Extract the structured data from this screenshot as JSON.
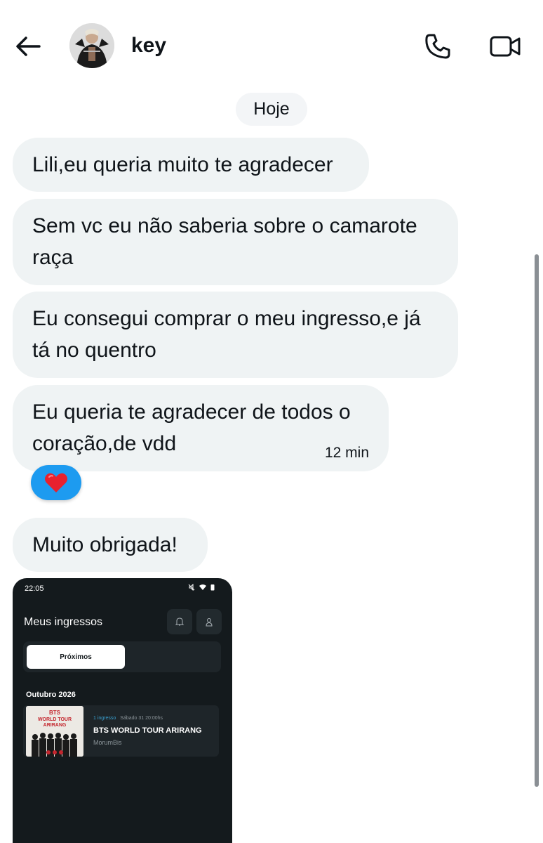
{
  "header": {
    "contact_name": "key",
    "back_icon": "arrow-left-icon",
    "call_icon": "phone-icon",
    "video_icon": "video-camera-icon"
  },
  "date_separator": "Hoje",
  "messages": [
    {
      "lines": [
        "Lili,eu queria muito te agradecer"
      ]
    },
    {
      "lines": [
        "Sem vc eu não saberia sobre o camarote",
        "raça"
      ]
    },
    {
      "lines": [
        "Eu consegui comprar o meu ingresso,e já",
        "tá no quentro"
      ]
    },
    {
      "lines": [
        "Eu queria te agradecer de todos o",
        "coração,de vdd"
      ],
      "timestamp": "12 min",
      "reaction": "❤️"
    },
    {
      "lines": [
        "Muito obrigada!"
      ]
    }
  ],
  "colors": {
    "bubble": "#eff3f4",
    "reaction_bg": "#1d9bf0",
    "attachment_bg": "#141a1d"
  },
  "attachment": {
    "status_time": "22:05",
    "title": "Meus ingressos",
    "tab_active": "Próximos",
    "month": "Outubro 2026",
    "ticket_count": "1 ingresso",
    "event_date": "Sábado 31 20:00hs",
    "event_name": "BTS WORLD TOUR ARIRANG",
    "venue": "MorumBis",
    "poster_lines": [
      "BTS",
      "WORLD TOUR",
      "ARIRANG"
    ]
  }
}
